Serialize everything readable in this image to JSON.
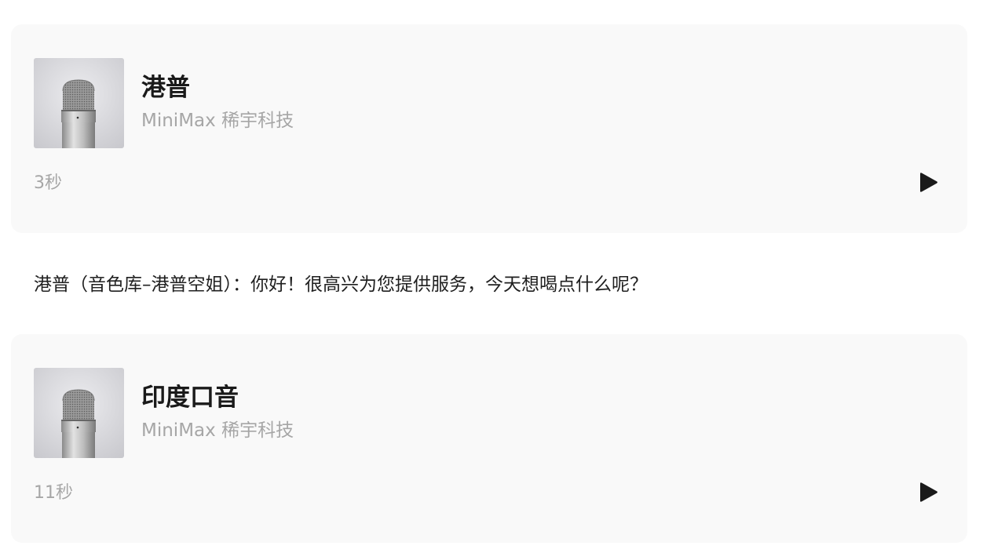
{
  "voices": [
    {
      "title": "港普",
      "provider": "MiniMax 稀宇科技",
      "duration": "3秒",
      "thumbnail_icon": "microphone-icon"
    },
    {
      "title": "印度口音",
      "provider": "MiniMax 稀宇科技",
      "duration": "11秒",
      "thumbnail_icon": "microphone-icon"
    }
  ],
  "message": {
    "text": "港普（音色库–港普空姐）：你好！很高兴为您提供服务，今天想喝点什么呢？"
  },
  "colors": {
    "card_bg": "#f9f9f9",
    "title": "#1a1a1a",
    "muted": "#a6a6a6",
    "play_icon": "#1a1a1a"
  }
}
